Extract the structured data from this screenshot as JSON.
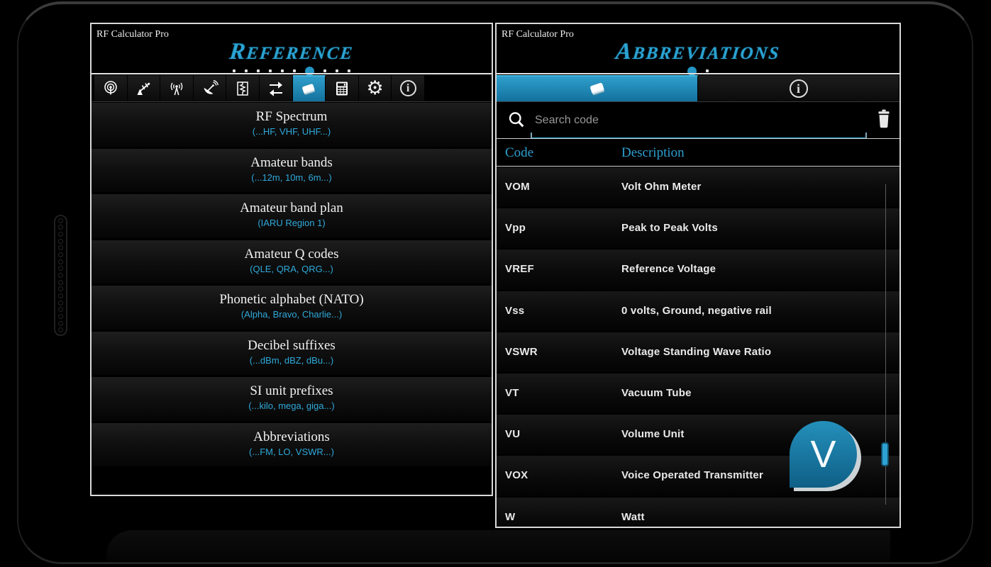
{
  "app_title": "RF Calculator Pro",
  "left_panel": {
    "title": "Reference",
    "pager": {
      "count": 10,
      "active_index": 7
    },
    "toolbar": {
      "icons": [
        "omni-antenna-icon",
        "directional-antenna-icon",
        "radio-tower-icon",
        "satellite-dish-icon",
        "resistor-icon",
        "swap-arrows-icon",
        "book-icon",
        "calculator-icon",
        "gear-icon",
        "info-icon"
      ],
      "active_icon": "book-icon"
    },
    "items": [
      {
        "title": "RF Spectrum",
        "subtitle": "(...HF, VHF, UHF...)"
      },
      {
        "title": "Amateur bands",
        "subtitle": "(...12m, 10m, 6m...)"
      },
      {
        "title": "Amateur band plan",
        "subtitle": "(IARU Region 1)"
      },
      {
        "title": "Amateur Q codes",
        "subtitle": "(QLE, QRA, QRG...)"
      },
      {
        "title": "Phonetic alphabet (NATO)",
        "subtitle": "(Alpha, Bravo, Charlie...)"
      },
      {
        "title": "Decibel suffixes",
        "subtitle": "(...dBm, dBZ, dBu...)"
      },
      {
        "title": "SI unit prefixes",
        "subtitle": "(...kilo, mega, giga...)"
      },
      {
        "title": "Abbreviations",
        "subtitle": "(...FM, LO, VSWR...)"
      }
    ]
  },
  "right_panel": {
    "title": "Abbreviations",
    "pager": {
      "count": 2,
      "active_index": 1
    },
    "tabs": [
      {
        "icon": "book-icon",
        "active": true
      },
      {
        "icon": "info-icon",
        "active": false
      }
    ],
    "search": {
      "placeholder": "Search code",
      "icons": [
        "search-icon",
        "trash-icon"
      ]
    },
    "table": {
      "headers": {
        "code": "Code",
        "description": "Description"
      },
      "rows": [
        {
          "code": "VOM",
          "description": "Volt Ohm Meter"
        },
        {
          "code": "Vpp",
          "description": "Peak to Peak Volts"
        },
        {
          "code": "VREF",
          "description": "Reference Voltage"
        },
        {
          "code": "Vss",
          "description": "0 volts, Ground, negative rail"
        },
        {
          "code": "VSWR",
          "description": "Voltage Standing Wave Ratio"
        },
        {
          "code": "VT",
          "description": "Vacuum Tube"
        },
        {
          "code": "VU",
          "description": "Volume Unit"
        },
        {
          "code": "VOX",
          "description": "Voice Operated Transmitter"
        },
        {
          "code": "W",
          "description": "Watt"
        }
      ]
    },
    "fast_scroll": {
      "letter": "V"
    }
  },
  "colors": {
    "accent_blue": "#33b5e5",
    "tab_active_top": "#2f9ecb",
    "tab_active_bottom": "#13719d",
    "table_header_text": "#2e9fd0",
    "bubble_top": "#2490bb",
    "bubble_bottom": "#0e5f86",
    "thumb_blue": "#2da2d2"
  }
}
